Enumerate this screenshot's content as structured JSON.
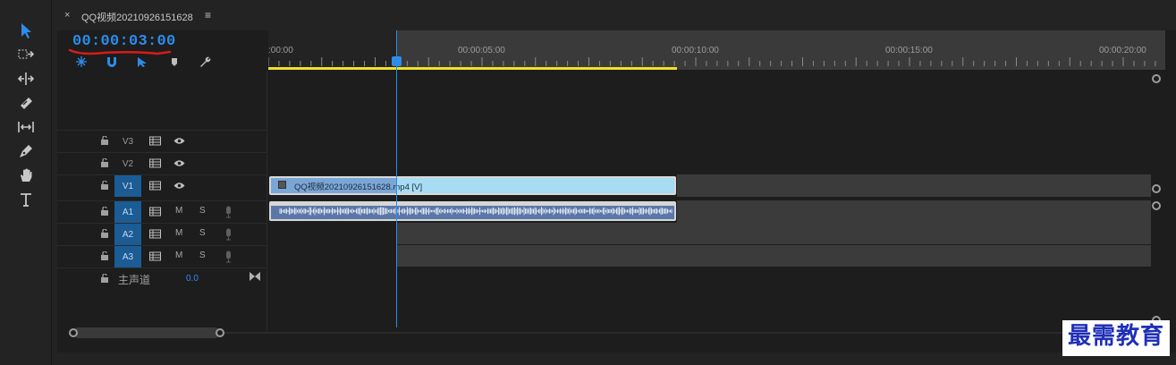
{
  "sequence": {
    "tab_title": "QQ视频20210926151628",
    "tab_close": "×",
    "tab_menu": "≡",
    "timecode": "00:00:03:00"
  },
  "ruler": {
    "labels": [
      ":00:00",
      "00:00:05:00",
      "00:00:10:00",
      "00:00:15:00",
      "00:00:20:00"
    ]
  },
  "tracks": {
    "video": [
      {
        "name": "V3",
        "targeted": false
      },
      {
        "name": "V2",
        "targeted": false
      },
      {
        "name": "V1",
        "targeted": true
      }
    ],
    "audio": [
      {
        "name": "A1",
        "targeted": true,
        "m": "M",
        "s": "S"
      },
      {
        "name": "A2",
        "targeted": true,
        "m": "M",
        "s": "S"
      },
      {
        "name": "A3",
        "targeted": true,
        "m": "M",
        "s": "S"
      }
    ],
    "master": {
      "name": "主声道",
      "value": "0.0"
    }
  },
  "clips": {
    "video_label": "QQ视频20210926151628.mp4 [V]"
  },
  "watermark": "最需教育",
  "colors": {
    "accent": "#2d8ceb",
    "workarea": "#f0e12a",
    "video_clip": "#a8dcf3",
    "audio_clip": "#5b77a8",
    "track_target": "#1b5c95"
  }
}
